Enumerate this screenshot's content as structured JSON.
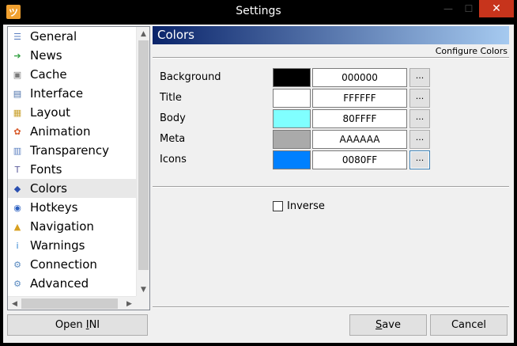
{
  "window": {
    "title": "Settings",
    "app_icon_glyph": "ツ",
    "minimize_glyph": "—",
    "maximize_glyph": "☐",
    "close_glyph": "✕"
  },
  "sidebar": {
    "items": [
      {
        "label": "General",
        "icon": "general-icon",
        "glyph": "☰",
        "color": "#5a7fc0"
      },
      {
        "label": "News",
        "icon": "news-icon",
        "glyph": "➔",
        "color": "#2e9e3e"
      },
      {
        "label": "Cache",
        "icon": "cache-icon",
        "glyph": "▣",
        "color": "#7a7a7a"
      },
      {
        "label": "Interface",
        "icon": "interface-icon",
        "glyph": "▤",
        "color": "#4a6fa8"
      },
      {
        "label": "Layout",
        "icon": "layout-icon",
        "glyph": "▦",
        "color": "#c9a02c"
      },
      {
        "label": "Animation",
        "icon": "animation-icon",
        "glyph": "✿",
        "color": "#d85a2a"
      },
      {
        "label": "Transparency",
        "icon": "transparency-icon",
        "glyph": "▥",
        "color": "#5a7fc0"
      },
      {
        "label": "Fonts",
        "icon": "fonts-icon",
        "glyph": "T",
        "color": "#5a5a9a"
      },
      {
        "label": "Colors",
        "icon": "colors-icon",
        "glyph": "◆",
        "color": "#2a4fb0"
      },
      {
        "label": "Hotkeys",
        "icon": "hotkeys-icon",
        "glyph": "◉",
        "color": "#2a5fc0"
      },
      {
        "label": "Navigation",
        "icon": "navigation-icon",
        "glyph": "▲",
        "color": "#d8a020"
      },
      {
        "label": "Warnings",
        "icon": "warnings-icon",
        "glyph": "i",
        "color": "#2a7fd0"
      },
      {
        "label": "Connection",
        "icon": "connection-icon",
        "glyph": "⚙",
        "color": "#5a8ac0"
      },
      {
        "label": "Advanced",
        "icon": "advanced-icon",
        "glyph": "⚙",
        "color": "#5a8ac0"
      }
    ],
    "selected_index": 8,
    "scroll_up_glyph": "▲",
    "scroll_down_glyph": "▼",
    "scroll_left_glyph": "◀",
    "scroll_right_glyph": "▶"
  },
  "panel": {
    "title": "Colors",
    "subtitle": "Configure Colors",
    "rows": [
      {
        "label": "Background",
        "hex": "000000",
        "color": "#000000",
        "button": "..."
      },
      {
        "label": "Title",
        "hex": "FFFFFF",
        "color": "#FFFFFF",
        "button": "..."
      },
      {
        "label": "Body",
        "hex": "80FFFF",
        "color": "#80FFFF",
        "button": "..."
      },
      {
        "label": "Meta",
        "hex": "AAAAAA",
        "color": "#AAAAAA",
        "button": "..."
      },
      {
        "label": "Icons",
        "hex": "0080FF",
        "color": "#0080FF",
        "button": "..."
      }
    ],
    "inverse_label": "Inverse",
    "inverse_checked": false
  },
  "buttons": {
    "open_ini": {
      "before": "Open ",
      "underline": "I",
      "after": "NI"
    },
    "save": {
      "before": "",
      "underline": "S",
      "after": "ave"
    },
    "cancel": "Cancel"
  }
}
